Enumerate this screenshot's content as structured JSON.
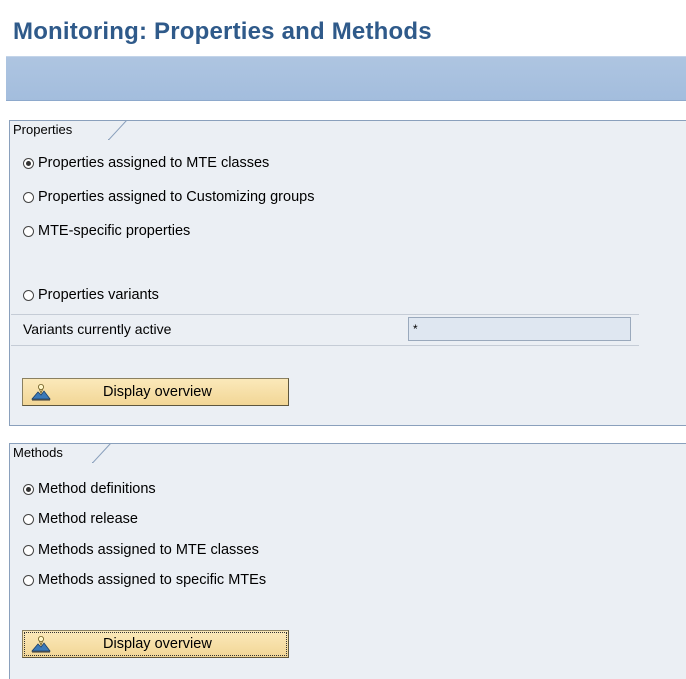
{
  "page": {
    "title": "Monitoring: Properties and Methods"
  },
  "properties_group": {
    "tab_label": "Properties",
    "options": [
      {
        "label": "Properties assigned to MTE classes",
        "checked": true
      },
      {
        "label": "Properties assigned to Customizing groups",
        "checked": false
      },
      {
        "label": "MTE-specific properties",
        "checked": false
      },
      {
        "label": "Properties variants",
        "checked": false
      }
    ],
    "variants_field": {
      "label": "Variants currently active",
      "value": "*"
    },
    "button_label": "Display overview",
    "button_icon": "overview-icon"
  },
  "methods_group": {
    "tab_label": "Methods",
    "options": [
      {
        "label": "Method definitions",
        "checked": true
      },
      {
        "label": "Method release",
        "checked": false
      },
      {
        "label": "Methods assigned to MTE classes",
        "checked": false
      },
      {
        "label": "Methods assigned to specific MTEs",
        "checked": false
      }
    ],
    "button_label": "Display overview",
    "button_icon": "overview-icon"
  },
  "colors": {
    "title": "#2f5a8a",
    "toolbar": "#a9c1df",
    "group_background": "#ebeff4",
    "button": "#f6dfa6"
  }
}
